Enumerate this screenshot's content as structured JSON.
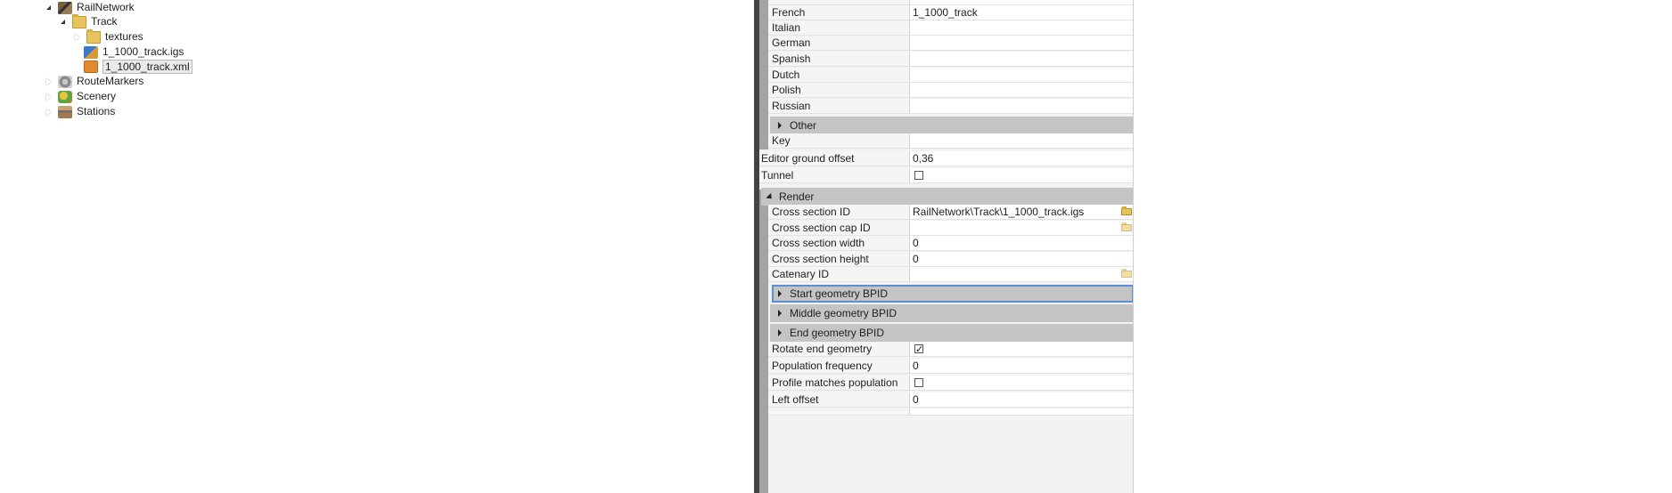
{
  "tree": {
    "rail_network": "RailNetwork",
    "track": "Track",
    "textures": "textures",
    "igs_file": "1_1000_track.igs",
    "xml_file": "1_1000_track.xml",
    "route_markers": "RouteMarkers",
    "scenery": "Scenery",
    "stations": "Stations"
  },
  "properties": {
    "languages": {
      "french_label": "French",
      "french_value": "1_1000_track",
      "italian_label": "Italian",
      "german_label": "German",
      "spanish_label": "Spanish",
      "dutch_label": "Dutch",
      "polish_label": "Polish",
      "russian_label": "Russian"
    },
    "other_category": "Other",
    "key_label": "Key",
    "editor_ground_offset_label": "Editor ground offset",
    "editor_ground_offset_value": "0,36",
    "tunnel_label": "Tunnel",
    "tunnel_checked": false,
    "render_category": "Render",
    "cross_section_id_label": "Cross section ID",
    "cross_section_id_value": "RailNetwork\\Track\\1_1000_track.igs",
    "cross_section_cap_id_label": "Cross section cap ID",
    "cross_section_width_label": "Cross section width",
    "cross_section_width_value": "0",
    "cross_section_height_label": "Cross section height",
    "cross_section_height_value": "0",
    "catenary_id_label": "Catenary ID",
    "start_geometry_category": "Start geometry BPID",
    "middle_geometry_category": "Middle geometry BPID",
    "end_geometry_category": "End geometry BPID",
    "rotate_end_geometry_label": "Rotate end geometry",
    "rotate_end_geometry_checked": true,
    "population_frequency_label": "Population frequency",
    "population_frequency_value": "0",
    "profile_matches_population_label": "Profile matches population",
    "profile_matches_population_checked": false,
    "left_offset_label": "Left offset",
    "left_offset_value": "0"
  }
}
